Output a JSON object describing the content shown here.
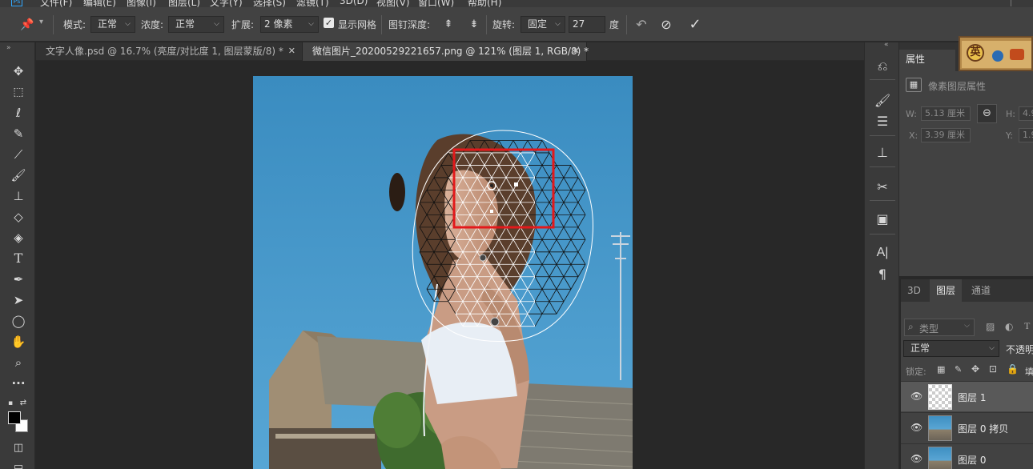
{
  "menubar": {
    "items": [
      "文件(F)",
      "编辑(E)",
      "图像(I)",
      "图层(L)",
      "文字(Y)",
      "选择(S)",
      "滤镜(T)",
      "3D(D)",
      "视图(V)",
      "窗口(W)",
      "帮助(H)"
    ]
  },
  "options_bar": {
    "mode_label": "模式:",
    "mode_value": "正常",
    "density_label": "浓度:",
    "density_value": "正常",
    "expand_label": "扩展:",
    "expand_value": "2 像素",
    "show_mesh_label": "显示网格",
    "show_mesh_checked": true,
    "pin_depth_label": "图钉深度:",
    "rotate_label": "旋转:",
    "rotate_mode": "固定",
    "rotate_value": "27",
    "rotate_unit": "度"
  },
  "document_tabs": [
    {
      "title": "文字人像.psd @ 16.7% (亮度/对比度 1, 图层蒙版/8) *",
      "active": false
    },
    {
      "title": "微信图片_20200529221657.png @ 121% (图层 1, RGB/8) *",
      "active": true
    }
  ],
  "properties_panel": {
    "tab": "属性",
    "subtitle": "像素图层属性",
    "w_label": "W:",
    "w_value": "5.13 厘米",
    "h_label": "H:",
    "h_value": "4.9",
    "x_label": "X:",
    "x_value": "3.39 厘米",
    "y_label": "Y:",
    "y_value": "1.9"
  },
  "layers_panel": {
    "tabs": [
      "3D",
      "图层",
      "通道"
    ],
    "active_tab": "图层",
    "filter_placeholder": "类型",
    "blend_mode": "正常",
    "opacity_label": "不透明",
    "lock_label": "锁定:",
    "fill_label": "填",
    "layers": [
      {
        "name": "图层 1",
        "selected": true,
        "thumb": "transparent"
      },
      {
        "name": "图层 0 拷贝",
        "selected": false,
        "thumb": "photo"
      },
      {
        "name": "图层 0",
        "selected": false,
        "thumb": "photo"
      }
    ]
  },
  "colors": {
    "accent_blue": "#31a8ff",
    "selection_red": "#e3191b",
    "sky": "#3d8fc2"
  }
}
